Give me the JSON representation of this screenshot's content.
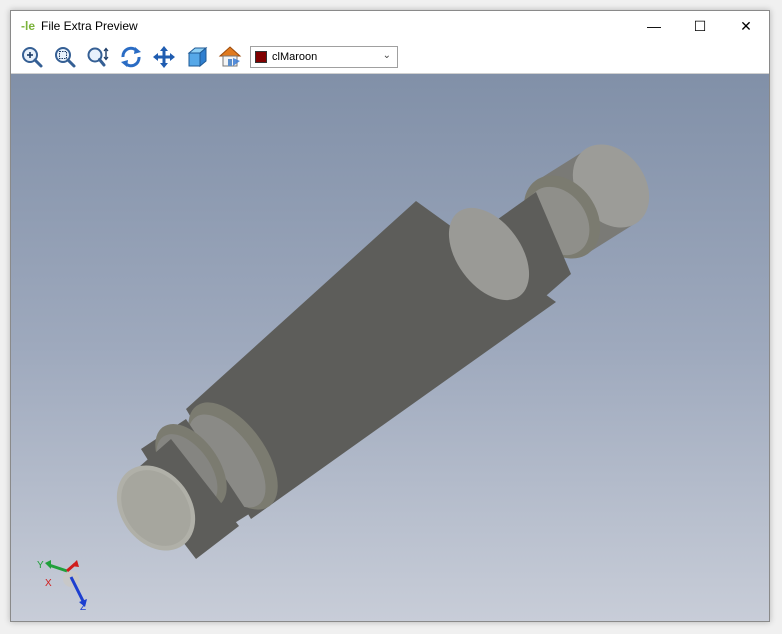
{
  "window": {
    "title": "File Extra Preview",
    "app_icon_glyph": "-le",
    "controls": {
      "minimize": "—",
      "maximize": "☐",
      "close": "✕"
    }
  },
  "toolbar": {
    "buttons": [
      {
        "name": "zoom-in-icon"
      },
      {
        "name": "zoom-window-icon"
      },
      {
        "name": "zoom-fit-icon"
      },
      {
        "name": "rotate-icon"
      },
      {
        "name": "pan-icon"
      },
      {
        "name": "view-cube-icon"
      },
      {
        "name": "home-view-icon"
      }
    ],
    "color_select": {
      "value": "clMaroon",
      "swatch_color": "#800000"
    }
  },
  "viewport": {
    "axis_labels": {
      "y": "Y",
      "x": "X",
      "z": "Z"
    },
    "part_color": "#8e8e8a"
  }
}
